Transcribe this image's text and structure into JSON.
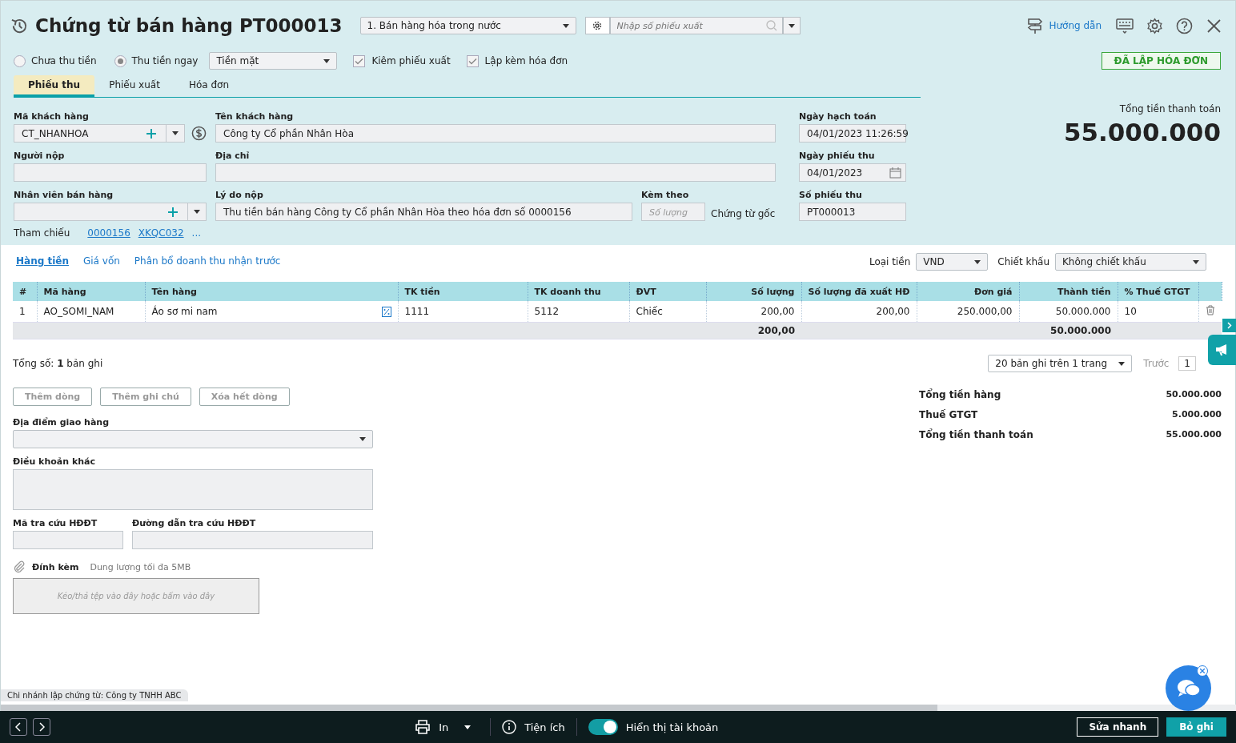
{
  "title": "Chứng từ bán hàng PT000013",
  "sale_type": "1. Bán hàng hóa trong nước",
  "search": {
    "placeholder": "Nhập số phiếu xuất"
  },
  "help_link": "Hướng dẫn",
  "payment_options": [
    {
      "label": "Chưa thu tiền",
      "selected": false
    },
    {
      "label": "Thu tiền ngay",
      "selected": true
    }
  ],
  "payment_method": "Tiền mặt",
  "checkboxes": [
    {
      "label": "Kiêm phiếu xuất",
      "checked": true
    },
    {
      "label": "Lập kèm hóa đơn",
      "checked": true
    }
  ],
  "status_badge": "ĐÃ LẬP HÓA ĐƠN",
  "tabs": [
    {
      "label": "Phiếu thu",
      "selected": true
    },
    {
      "label": "Phiếu xuất",
      "selected": false
    },
    {
      "label": "Hóa đơn",
      "selected": false
    }
  ],
  "fields": {
    "customer_code": {
      "label": "Mã khách hàng",
      "value": "CT_NHANHOA"
    },
    "customer_name": {
      "label": "Tên khách hàng",
      "value": "Công ty Cổ phần Nhân Hòa"
    },
    "posting_date": {
      "label": "Ngày hạch toán",
      "value": "04/01/2023 11:26:59"
    },
    "payer": {
      "label": "Người nộp"
    },
    "address": {
      "label": "Địa chỉ"
    },
    "receipt_date": {
      "label": "Ngày phiếu thu",
      "value": "04/01/2023"
    },
    "salesperson": {
      "label": "Nhân viên bán hàng"
    },
    "reason": {
      "label": "Lý do nộp",
      "value": "Thu tiền bán hàng Công ty Cổ phần Nhân Hòa theo hóa đơn số 0000156"
    },
    "attached": {
      "label": "Kèm theo",
      "placeholder": "Số lượng",
      "suffix": "Chứng từ gốc"
    },
    "receipt_no": {
      "label": "Số phiếu thu",
      "value": "PT000013"
    }
  },
  "references": {
    "label": "Tham chiếu",
    "links": [
      "0000156",
      "XKQC032"
    ],
    "more": "..."
  },
  "total": {
    "label": "Tổng tiền thanh toán",
    "value": "55.000.000"
  },
  "detail_tabs": [
    {
      "label": "Hàng tiền",
      "selected": true
    },
    {
      "label": "Giá vốn",
      "selected": false
    },
    {
      "label": "Phân bổ doanh thu nhận trước",
      "selected": false
    }
  ],
  "currency": {
    "label": "Loại tiền",
    "value": "VND"
  },
  "discount": {
    "label": "Chiết khấu",
    "value": "Không chiết khấu"
  },
  "table": {
    "columns": [
      {
        "label": "#",
        "kind": "text"
      },
      {
        "label": "Mã hàng",
        "kind": "text"
      },
      {
        "label": "Tên hàng",
        "kind": "text"
      },
      {
        "label": "TK tiền",
        "kind": "text"
      },
      {
        "label": "TK doanh thu",
        "kind": "text"
      },
      {
        "label": "ĐVT",
        "kind": "text"
      },
      {
        "label": "Số lượng",
        "kind": "number"
      },
      {
        "label": "Số lượng đã xuất HĐ",
        "kind": "number"
      },
      {
        "label": "Đơn giá",
        "kind": "number"
      },
      {
        "label": "Thành tiền",
        "kind": "number"
      },
      {
        "label": "% Thuế GTGT",
        "kind": "text"
      }
    ],
    "rows": [
      [
        "1",
        "AO_SOMI_NAM",
        "Áo sơ mi nam",
        "1111",
        "5112",
        "Chiếc",
        "200,00",
        "200,00",
        "250.000,00",
        "50.000.000",
        "10"
      ]
    ],
    "summary": {
      "quantity": "200,00",
      "amount": "50.000.000"
    }
  },
  "record_count": "Tổng số: **1** bản ghi",
  "page_size": "20 bản ghi trên 1 trang",
  "pager": {
    "prev": "Trước",
    "page": "1"
  },
  "row_buttons": [
    "Thêm dòng",
    "Thêm ghi chú",
    "Xóa hết dòng"
  ],
  "bottom_fields": {
    "delivery": {
      "label": "Địa điểm giao hàng"
    },
    "terms": {
      "label": "Điều khoản khác"
    },
    "lookup_code": {
      "label": "Mã tra cứu HĐĐT"
    },
    "lookup_url": {
      "label": "Đường dẫn tra cứu HĐĐT"
    }
  },
  "attachment": {
    "label": "Đính kèm",
    "hint": "Dung lượng tối đa 5MB",
    "dropzone": "Kéo/thả tệp vào đây hoặc bấm vào đây"
  },
  "totals": [
    {
      "label": "Tổng tiền hàng",
      "value": "50.000.000"
    },
    {
      "label": "Thuế GTGT",
      "value": "5.000.000"
    },
    {
      "label": "Tổng tiền thanh toán",
      "value": "55.000.000"
    }
  ],
  "branch": "Chi nhánh lập chứng từ: Công ty TNHH ABC",
  "footer": {
    "print": "In",
    "utilities": "Tiện ích",
    "show_accounts": {
      "label": "Hiển thị tài khoản",
      "on": true
    },
    "quick_edit": "Sửa nhanh",
    "unpost": "Bỏ ghi"
  }
}
